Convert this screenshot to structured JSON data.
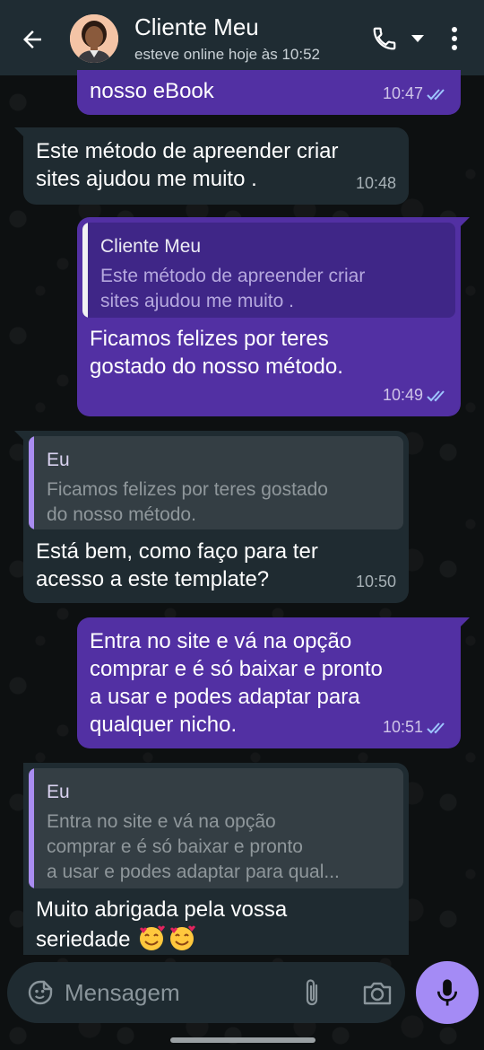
{
  "header": {
    "contact_name": "Cliente Meu",
    "status": "esteve online hoje às 10:52",
    "back_icon": "arrow-left-icon",
    "call_icon": "phone-icon",
    "menu_icon": "more-vert-icon"
  },
  "colors": {
    "header_bg": "#1f2c33",
    "outgoing_bubble": "#5230a3",
    "incoming_bubble": "#1f2b31",
    "read_ticks": "#9ec6ff",
    "mic_button": "#a48bf5"
  },
  "messages": [
    {
      "direction": "out",
      "text": "nosso eBook",
      "time": "10:47",
      "status": "read"
    },
    {
      "direction": "in",
      "text": "Este método de apreender criar\nsites ajudou me muito .",
      "time": "10:48"
    },
    {
      "direction": "out",
      "quote": {
        "author": "Cliente Meu",
        "text": "Este método de apreender criar\nsites ajudou me muito ."
      },
      "text": "Ficamos felizes por teres\ngostado do nosso método.",
      "time": "10:49",
      "status": "read"
    },
    {
      "direction": "in",
      "quote": {
        "author": "Eu",
        "text": "Ficamos felizes por teres gostado\ndo nosso método."
      },
      "text": "Está bem,  como faço para ter\nacesso a este template?",
      "time": "10:50"
    },
    {
      "direction": "out",
      "text": "Entra no site e vá na opção\ncomprar e é só baixar e pronto\na usar e podes adaptar para\nqualquer nicho.",
      "time": "10:51",
      "status": "read"
    },
    {
      "direction": "in",
      "quote": {
        "author": "Eu",
        "text": "Entra no site e vá na opção\ncomprar e é só baixar e pronto\na usar e podes adaptar para qual..."
      },
      "text": "Muito abrigada pela vossa\nseriedade",
      "emojis": [
        "smiling-face-with-hearts-icon",
        "smiling-face-with-hearts-icon"
      ]
    }
  ],
  "composer": {
    "placeholder": "Mensagem",
    "emoji_icon": "sticker-emoji-icon",
    "attach_icon": "paperclip-icon",
    "camera_icon": "camera-icon",
    "mic_icon": "microphone-icon"
  }
}
